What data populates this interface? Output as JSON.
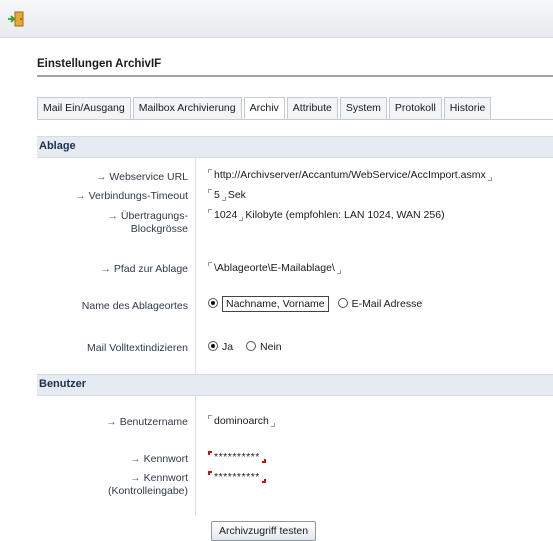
{
  "page": {
    "title": "Einstellungen ArchivIF"
  },
  "tabs": [
    {
      "label": "Mail Ein/Ausgang",
      "active": false
    },
    {
      "label": "Mailbox Archivierung",
      "active": false
    },
    {
      "label": "Archiv",
      "active": true
    },
    {
      "label": "Attribute",
      "active": false
    },
    {
      "label": "System",
      "active": false
    },
    {
      "label": "Protokoll",
      "active": false
    },
    {
      "label": "Historie",
      "active": false
    }
  ],
  "ablage": {
    "heading": "Ablage",
    "webservice_label": "Webservice URL",
    "webservice_value": "http://Archivserver/Accantum/WebService/AccImport.asmx",
    "timeout_label": "Verbindungs-Timeout",
    "timeout_value": "5",
    "timeout_unit": "Sek",
    "block_label_1": "Übertragungs-",
    "block_label_2": "Blockgrösse",
    "block_value": "1024",
    "block_unit": "Kilobyte (empfohlen: LAN 1024, WAN 256)",
    "pfad_label": "Pfad zur Ablage",
    "pfad_value": "\\Ablageorte\\E-Mailablage\\",
    "name_label": "Name des Ablageortes",
    "name_option_1": "Nachname, Vorname",
    "name_option_2": "E-Mail Adresse",
    "volltext_label": "Mail Volltextindizieren",
    "volltext_option_1": "Ja",
    "volltext_option_2": "Nein"
  },
  "benutzer": {
    "heading": "Benutzer",
    "username_label": "Benutzername",
    "username_value": "dominoarch",
    "password_label": "Kennwort",
    "password_value": "**********",
    "password_confirm_label_1": "Kennwort",
    "password_confirm_label_2": "(Kontrolleingabe)",
    "password_confirm_value": "**********"
  },
  "actions": {
    "test_button": "Archivzugriff testen"
  },
  "icons": {
    "app": "door-exit-icon",
    "label_arrow": "arrow-right-icon"
  },
  "colors": {
    "section_bg": "#e6ebf2",
    "password_marker": "#cc1010"
  }
}
